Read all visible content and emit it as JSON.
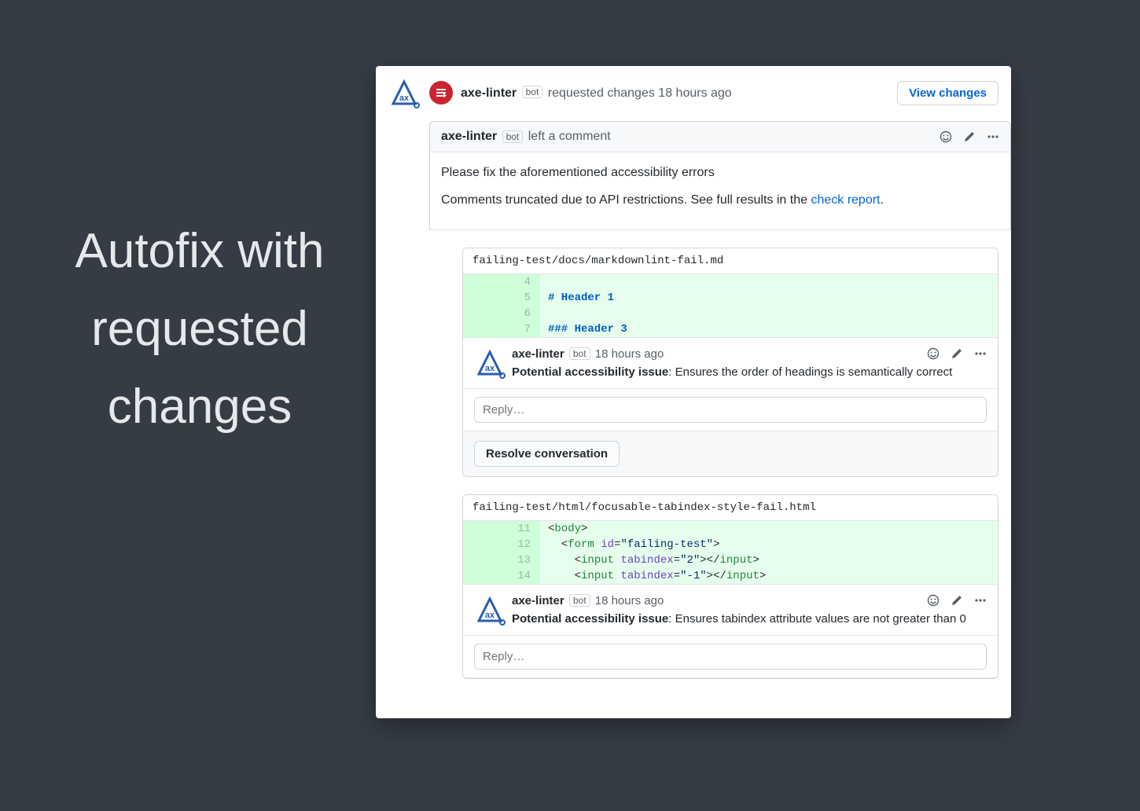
{
  "title": "Autofix with requested changes",
  "review": {
    "bot_name": "axe-linter",
    "bot_label": "bot",
    "action": "requested changes",
    "timestamp": "18 hours ago",
    "view_changes": "View changes"
  },
  "comment": {
    "bot_name": "axe-linter",
    "bot_label": "bot",
    "action": "left a comment",
    "body_line1": "Please fix the aforementioned accessibility errors",
    "body_line2_prefix": "Comments truncated due to API restrictions. See full results in the ",
    "body_line2_link": "check report",
    "body_line2_suffix": "."
  },
  "icons": {
    "emoji": "emoji-icon",
    "pencil": "pencil-icon",
    "kebab": "kebab-icon"
  },
  "files": [
    {
      "path": "failing-test/docs/markdownlint-fail.md",
      "lines": [
        {
          "n": 4,
          "text": ""
        },
        {
          "n": 5,
          "text": "# Header 1"
        },
        {
          "n": 6,
          "text": ""
        },
        {
          "n": 7,
          "text": "### Header 3"
        }
      ],
      "comment": {
        "bot_name": "axe-linter",
        "bot_label": "bot",
        "timestamp": "18 hours ago",
        "issue_label": "Potential accessibility issue",
        "issue_text": ": Ensures the order of headings is semantically correct"
      },
      "reply_placeholder": "Reply…",
      "resolve_label": "Resolve conversation"
    },
    {
      "path": "failing-test/html/focusable-tabindex-style-fail.html",
      "lines": [
        {
          "n": 11,
          "html": "<body>"
        },
        {
          "n": 12,
          "html": "  <form id=\"failing-test\">"
        },
        {
          "n": 13,
          "html": "    <input tabindex=\"2\"></input>"
        },
        {
          "n": 14,
          "html": "    <input tabindex=\"-1\"></input>"
        }
      ],
      "comment": {
        "bot_name": "axe-linter",
        "bot_label": "bot",
        "timestamp": "18 hours ago",
        "issue_label": "Potential accessibility issue",
        "issue_text": ": Ensures tabindex attribute values are not greater than 0"
      },
      "reply_placeholder": "Reply…"
    }
  ]
}
